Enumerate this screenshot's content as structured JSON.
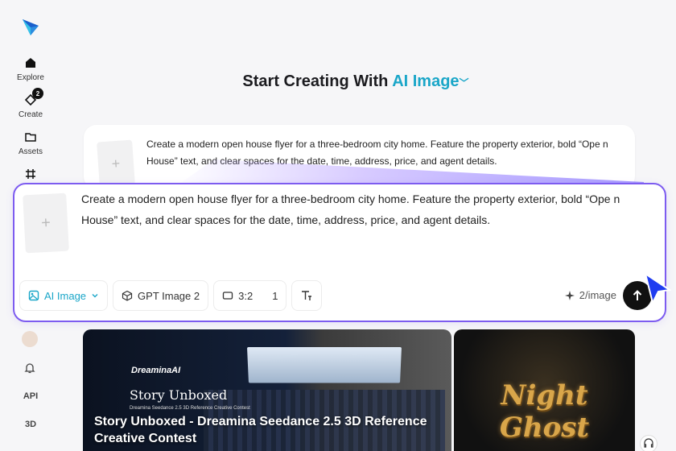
{
  "sidebar": {
    "items": [
      {
        "label": "Explore",
        "icon": "home-icon"
      },
      {
        "label": "Create",
        "icon": "create-icon",
        "badge": "2"
      },
      {
        "label": "Assets",
        "icon": "folder-icon"
      },
      {
        "label": "",
        "icon": "frame-icon"
      }
    ],
    "bottom": {
      "api_label": "API",
      "three_d_label": "3D"
    }
  },
  "header": {
    "title_prefix": "Start Creating With",
    "mode_label": "AI Image"
  },
  "ghost_card": {
    "text": "Create a modern open house flyer for a three-bedroom city home. Feature the property exterior, bold “Ope n House” text, and clear spaces for the date, time, address, price, and agent details."
  },
  "prompt": {
    "text": "Create a modern open house flyer for a three-bedroom city home. Feature the property exterior, bold “Ope n House” text, and clear spaces for the date, time, address, price, and agent details.",
    "mode_button": "AI Image",
    "model_button": "GPT Image 2",
    "ratio": "3:2",
    "count": "1",
    "credits": "2/image"
  },
  "banners": [
    {
      "logo_text": "DreaminaAI",
      "script_title": "Story Unboxed",
      "tiny_text": "Dreamina Seedance 2.5 3D Reference Creative Contest",
      "caption": "Story Unboxed - Dreamina Seedance 2.5 3D Reference Creative Contest"
    },
    {
      "title": "Night Ghost"
    }
  ],
  "colors": {
    "accent": "#1aa6c8",
    "border_active": "#7d5cf0",
    "send_button": "#111111"
  }
}
